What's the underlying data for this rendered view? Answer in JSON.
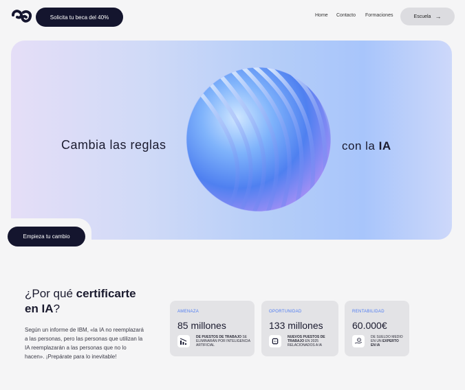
{
  "header": {
    "cta_label": "Solicita tu beca del 40%",
    "nav": [
      "Home",
      "Contacto",
      "Formaciones"
    ],
    "escuela_label": "Escuela",
    "escuela_icon": "arrow-right-icon"
  },
  "hero": {
    "left_text": "Cambia las reglas",
    "right_text_prefix": "con la ",
    "right_text_bold": "IA",
    "cta_label": "Empieza tu cambio"
  },
  "section": {
    "title_prefix": "¿Por qué ",
    "title_bold": "certificarte",
    "title_line2_prefix": "en IA",
    "title_line2_suffix": "?",
    "body": "Según un informe de IBM, «la IA no reemplazará a las personas, pero las personas que utilizan la IA reemplazarán a las personas que no lo hacen». ¡Prepárate para lo inevitable!"
  },
  "cards": [
    {
      "tag": "AMENAZA",
      "value": "85 millones",
      "icon": "chart-down-icon",
      "desc_bold": "DE PUESTOS DE TRABAJO",
      "desc_rest": " SE ELIMINARÁN POR INTELIGENCIA ARTIFICIAL"
    },
    {
      "tag": "OPORTUNIDAD",
      "value": "133 millones",
      "icon": "ai-chip-icon",
      "desc_bold": "NUEVOS PUESTOS DE TRABAJO",
      "desc_rest": " EN 2025 RELACIONADOS A IA"
    },
    {
      "tag": "RENTABILIDAD",
      "value": "60.000€",
      "icon": "money-hand-icon",
      "desc_bold": "",
      "desc_rest": "DE SUELDO MEDIO EN UN ",
      "desc_bold_end": "EXPERTO EN IA"
    }
  ],
  "colors": {
    "dark": "#14152e",
    "accent": "#4d7bf2",
    "background": "#f5f5f6"
  }
}
